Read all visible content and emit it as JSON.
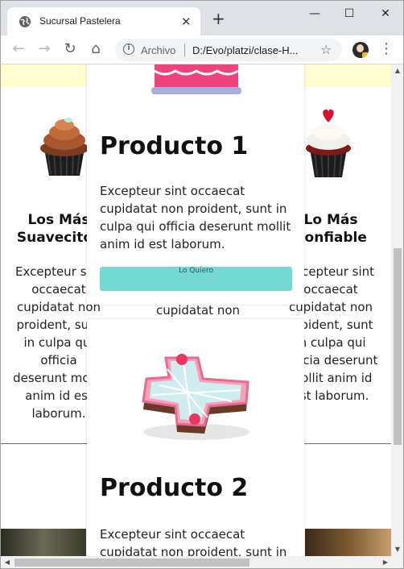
{
  "window": {
    "tab_title": "Sucursal Pastelera",
    "close_tab": "✕",
    "new_tab": "+",
    "minimize": "—",
    "maximize": "☐",
    "close": "✕"
  },
  "toolbar": {
    "back": "←",
    "forward": "→",
    "reload": "↻",
    "home": "⌂",
    "scheme_label": "Archivo",
    "url": "D:/Evo/platzi/clase-H...",
    "bookmark": "☆",
    "menu": "⋮"
  },
  "page": {
    "left_feature": {
      "heading_line1": "Los Más",
      "heading_line2": "Suavecitos",
      "text": "Excepteur sint occaecat cupidatat non proident, sunt in culpa qui officia deserunt mollit anim id est laborum."
    },
    "right_feature": {
      "heading_line1": "Lo Más",
      "heading_line2": "Confiable",
      "text": "Excepteur sint occaecat cupidatat non proident, sunt in culpa qui officia deserunt mollit anim id est laborum."
    },
    "middle_behind_text": "cupidatat non",
    "products": [
      {
        "title": "Producto 1",
        "description": "Excepteur sint occaecat cupidatat non proident, sunt in culpa qui officia deserunt mollit anim id est laborum.",
        "button": "Lo Quiero"
      },
      {
        "title": "Producto 2",
        "description": "Excepteur sint occaecat cupidatat non proident, sunt in"
      }
    ]
  },
  "colors": {
    "button": "#74d9d1",
    "banner": "#fdfdcf",
    "cake_pink": "#f0427c"
  }
}
